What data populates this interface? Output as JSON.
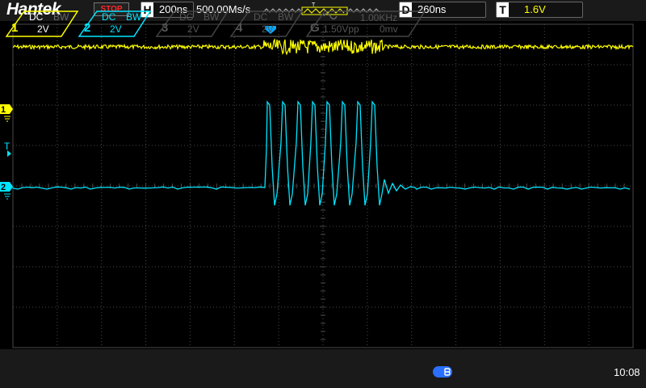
{
  "topbar": {
    "brand": "Hantek",
    "run_state": "STOP",
    "horizontal": {
      "letter": "H",
      "timebase": "200ns"
    },
    "sample_rate": "500.00Ms/s",
    "trigger_marker_letter": "T",
    "delay": {
      "letter": "D",
      "value": "260ns"
    },
    "trigger_level": {
      "letter": "T",
      "value": "1.6V"
    }
  },
  "screen": {
    "ch1_marker": "1",
    "ch2_marker": "2",
    "trigger_level_marker": "T",
    "colors": {
      "ch1": "#ffff00",
      "ch2": "#00e5ff",
      "grid": "#4a4a4a",
      "trigger": "#00aaff"
    }
  },
  "channels": [
    {
      "number": "1",
      "coupling": "DC",
      "bw": "BW",
      "scale": "2V",
      "active": true,
      "color": "#ffff00"
    },
    {
      "number": "2",
      "coupling": "DC",
      "bw": "BW",
      "scale": "2V",
      "active": true,
      "color": "#00e5ff"
    },
    {
      "number": "3",
      "coupling": "DC",
      "bw": "BW",
      "scale": "2V",
      "active": false,
      "color": "#555555"
    },
    {
      "number": "4",
      "coupling": "DC",
      "bw": "BW",
      "scale": "2V",
      "active": false,
      "color": "#555555"
    }
  ],
  "generator": {
    "letter": "G",
    "wave_icon": "sine-wave-icon",
    "frequency": "1.00KHz",
    "amplitude": "1.50Vpp",
    "offset": "0mv"
  },
  "status": {
    "connection_icon": "usb-icon",
    "clock": "10:08"
  }
}
